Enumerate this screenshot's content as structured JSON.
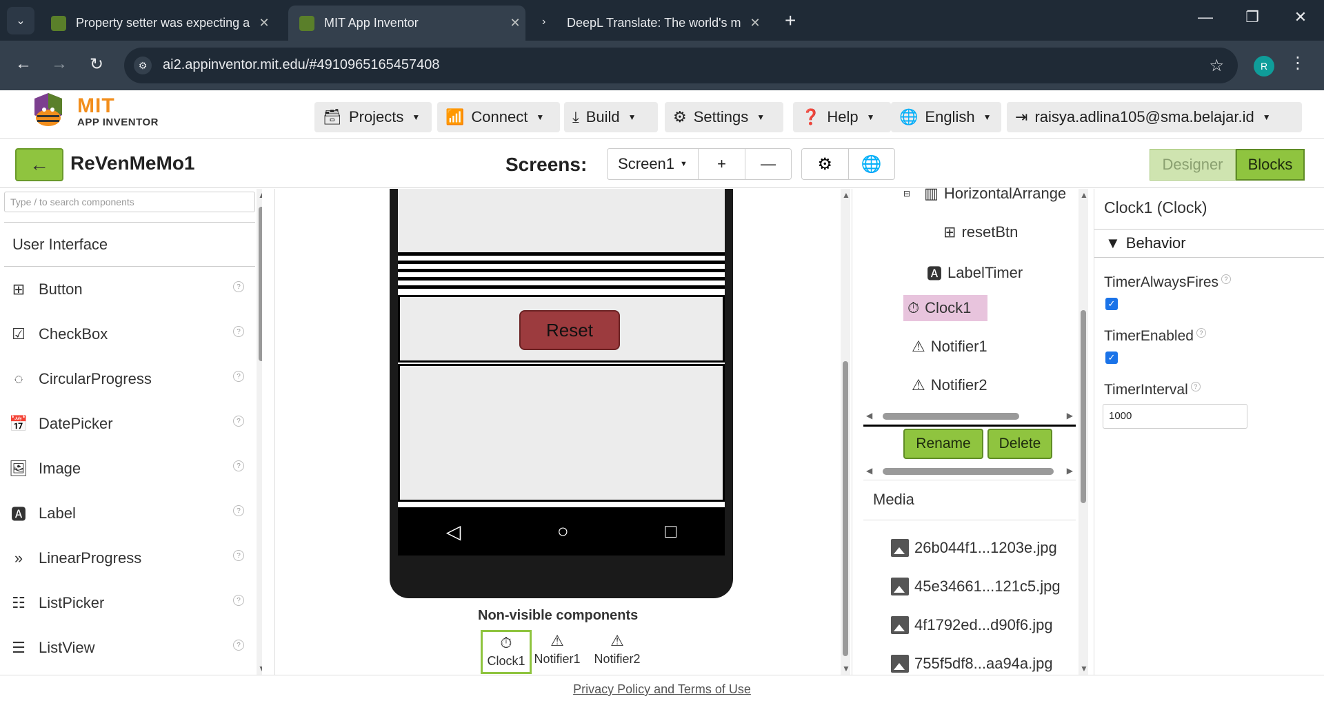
{
  "browser": {
    "tabs": [
      {
        "title": "Property setter was expecting a",
        "active": false
      },
      {
        "title": "MIT App Inventor",
        "active": true
      },
      {
        "title": "DeepL Translate: The world's m",
        "active": false
      }
    ],
    "url": "ai2.appinventor.mit.edu/#4910965165457408",
    "profile_initial": "R"
  },
  "header": {
    "logo_mit": "MIT",
    "logo_app": "APP INVENTOR",
    "menus": [
      "Projects",
      "Connect",
      "Build",
      "Settings",
      "Help",
      "English",
      "raisya.adlina105@sma.belajar.id"
    ]
  },
  "project": {
    "name": "ReVenMeMo1",
    "screens_label": "Screens:",
    "current_screen": "Screen1",
    "designer_label": "Designer",
    "blocks_label": "Blocks"
  },
  "palette": {
    "search_placeholder": "Type / to search components",
    "category": "User Interface",
    "items": [
      "Button",
      "CheckBox",
      "CircularProgress",
      "DatePicker",
      "Image",
      "Label",
      "LinearProgress",
      "ListPicker",
      "ListView"
    ]
  },
  "viewer": {
    "reset_label": "Reset",
    "nonvisible_label": "Non-visible components",
    "nonvisible": [
      "Clock1",
      "Notifier1",
      "Notifier2"
    ]
  },
  "tree": {
    "nodes": [
      "HorizontalArrange",
      "resetBtn",
      "LabelTimer",
      "Clock1",
      "Notifier1",
      "Notifier2"
    ],
    "rename_label": "Rename",
    "delete_label": "Delete",
    "media_label": "Media",
    "media": [
      "26b044f1...1203e.jpg",
      "45e34661...121c5.jpg",
      "4f1792ed...d90f6.jpg",
      "755f5df8...aa94a.jpg"
    ]
  },
  "properties": {
    "title": "Clock1 (Clock)",
    "section": "Behavior",
    "timer_always_fires_label": "TimerAlwaysFires",
    "timer_always_fires": true,
    "timer_enabled_label": "TimerEnabled",
    "timer_enabled": true,
    "timer_interval_label": "TimerInterval",
    "timer_interval": "1000"
  },
  "footer": {
    "link": "Privacy Policy and Terms of Use"
  },
  "colors": {
    "accent_green": "#8fc43f",
    "reset_button": "#9c3b3e",
    "selected_node": "#e8c4dd"
  }
}
